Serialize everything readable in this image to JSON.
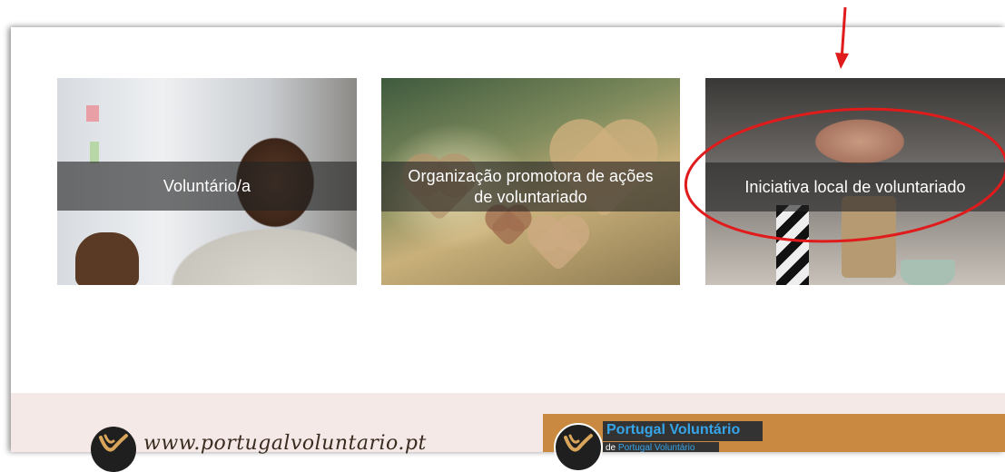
{
  "cards": [
    {
      "label": "Voluntário/a",
      "image": "smiling-man-photo"
    },
    {
      "label_line1": "Organização promotora de ações",
      "label_line2": "de voluntariado",
      "image": "hanging-hearts-photo"
    },
    {
      "label": "Iniciativa local de voluntariado",
      "image": "fist-bump-photo"
    }
  ],
  "annotations": {
    "arrow_color": "#e01b1b",
    "ellipse_color": "#e01b1b",
    "highlighted_card": "Iniciativa local de voluntariado"
  },
  "footer": {
    "site_url": "www.portugalvoluntario.pt",
    "facebook_box": {
      "title": "Portugal Voluntário",
      "subtitle_prefix": "de",
      "subtitle_link": "Portugal Voluntário",
      "background": "#c98940"
    }
  },
  "colors": {
    "label_band": "rgba(35,35,35,0.62)",
    "footer_bg": "#f4e9e6",
    "link_blue": "#36a4e8"
  }
}
